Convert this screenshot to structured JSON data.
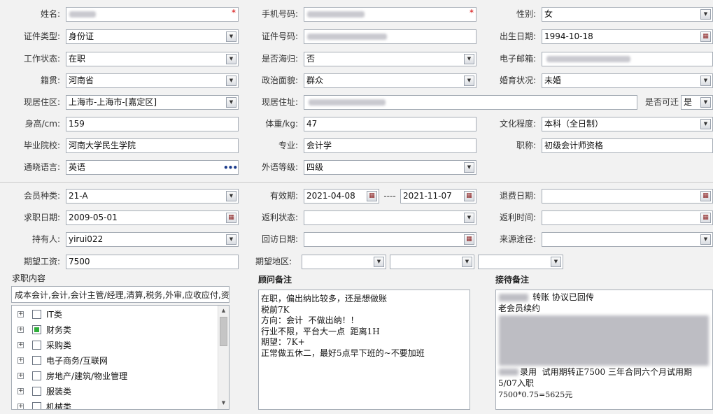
{
  "required_mark": "*",
  "labels": {
    "name": "姓名:",
    "mobile": "手机号码:",
    "gender": "性别:",
    "id_type": "证件类型:",
    "id_number": "证件号码:",
    "birth_date": "出生日期:",
    "work_status": "工作状态:",
    "returnee": "是否海归:",
    "email": "电子邮箱:",
    "native_place": "籍贯:",
    "political": "政治面貌:",
    "marital": "婚育状况:",
    "current_area": "现居住区:",
    "current_address": "现居住址:",
    "relocate": "是否可迁",
    "height": "身高/cm:",
    "weight": "体重/kg:",
    "education": "文化程度:",
    "school": "毕业院校:",
    "major": "专业:",
    "title": "职称:",
    "language": "通晓语言:",
    "foreign_level": "外语等级:",
    "member_type": "会员种类:",
    "valid_period": "有效期:",
    "refund_date": "退费日期:",
    "job_seek_date": "求职日期:",
    "rebate_status": "返利状态:",
    "rebate_time": "返利时间:",
    "holder": "持有人:",
    "revisit_date": "回访日期:",
    "source": "来源途径:",
    "expected_salary": "期望工资:",
    "expected_area": "期望地区:"
  },
  "values": {
    "gender": "女",
    "id_type": "身份证",
    "birth_date": "1994-10-18",
    "work_status": "在职",
    "returnee": "否",
    "native_place": "河南省",
    "political": "群众",
    "marital": "未婚",
    "current_area": "上海市-上海市-[嘉定区]",
    "relocate": "是",
    "height": "159",
    "weight": "47",
    "education": "本科（全日制）",
    "school": "河南大学民生学院",
    "major": "会计学",
    "title": "初级会计师资格",
    "language": "英语",
    "foreign_level": "四级",
    "member_type": "21-A",
    "valid_from": "2021-04-08",
    "valid_sep": "----",
    "valid_to": "2021-11-07",
    "job_seek_date": "2009-05-01",
    "holder": "yirui022",
    "expected_salary": "7500"
  },
  "job_content": {
    "title": "求职内容",
    "summary": "成本会计,会计,会计主管/经理,清算,税务,外审,应收应付,资",
    "tree": [
      {
        "label": "IT类",
        "checked": false
      },
      {
        "label": "财务类",
        "checked": true
      },
      {
        "label": "采购类",
        "checked": false
      },
      {
        "label": "电子商务/互联网",
        "checked": false
      },
      {
        "label": "房地产/建筑/物业管理",
        "checked": false
      },
      {
        "label": "服装类",
        "checked": false
      },
      {
        "label": "机械类",
        "checked": false
      }
    ]
  },
  "advisor_note": {
    "title": "顾问备注",
    "lines": [
      "在职，偏出纳比较多，还是想做账",
      "税前7K",
      "方向：会计  不做出纳！！",
      "行业不限，平台大一点  距离1H",
      "期望：7K+",
      "正常做五休二，最好5点早下班的~不要加班"
    ]
  },
  "reception_note": {
    "title": "接待备注",
    "line1": "转账 协议已回传",
    "line2": "老会员续约",
    "line3": "录用  试用期转正7500 三年合同六个月试用期",
    "line4": "5/07入职",
    "line5": "7500*0.75=5625元"
  },
  "icons": {
    "dropdown": "chevron-down-icon",
    "calendar": "calendar-icon",
    "more": "more-icon",
    "tree_expand": "plus-icon"
  },
  "colors": {
    "required": "#d40000",
    "checked": "#2fae3a",
    "more": "#1c3c8c"
  }
}
